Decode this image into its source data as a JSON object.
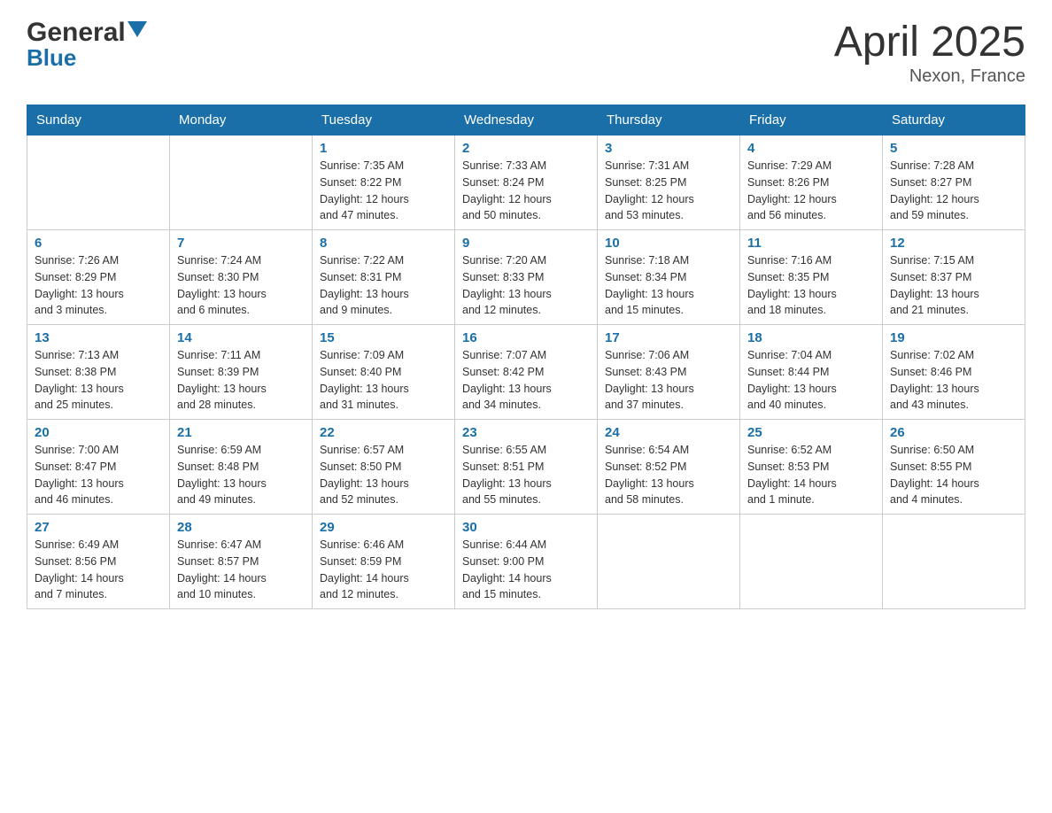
{
  "header": {
    "title": "April 2025",
    "subtitle": "Nexon, France",
    "logo_general": "General",
    "logo_blue": "Blue"
  },
  "calendar": {
    "days_of_week": [
      "Sunday",
      "Monday",
      "Tuesday",
      "Wednesday",
      "Thursday",
      "Friday",
      "Saturday"
    ],
    "weeks": [
      [
        {
          "day": "",
          "info": ""
        },
        {
          "day": "",
          "info": ""
        },
        {
          "day": "1",
          "info": "Sunrise: 7:35 AM\nSunset: 8:22 PM\nDaylight: 12 hours\nand 47 minutes."
        },
        {
          "day": "2",
          "info": "Sunrise: 7:33 AM\nSunset: 8:24 PM\nDaylight: 12 hours\nand 50 minutes."
        },
        {
          "day": "3",
          "info": "Sunrise: 7:31 AM\nSunset: 8:25 PM\nDaylight: 12 hours\nand 53 minutes."
        },
        {
          "day": "4",
          "info": "Sunrise: 7:29 AM\nSunset: 8:26 PM\nDaylight: 12 hours\nand 56 minutes."
        },
        {
          "day": "5",
          "info": "Sunrise: 7:28 AM\nSunset: 8:27 PM\nDaylight: 12 hours\nand 59 minutes."
        }
      ],
      [
        {
          "day": "6",
          "info": "Sunrise: 7:26 AM\nSunset: 8:29 PM\nDaylight: 13 hours\nand 3 minutes."
        },
        {
          "day": "7",
          "info": "Sunrise: 7:24 AM\nSunset: 8:30 PM\nDaylight: 13 hours\nand 6 minutes."
        },
        {
          "day": "8",
          "info": "Sunrise: 7:22 AM\nSunset: 8:31 PM\nDaylight: 13 hours\nand 9 minutes."
        },
        {
          "day": "9",
          "info": "Sunrise: 7:20 AM\nSunset: 8:33 PM\nDaylight: 13 hours\nand 12 minutes."
        },
        {
          "day": "10",
          "info": "Sunrise: 7:18 AM\nSunset: 8:34 PM\nDaylight: 13 hours\nand 15 minutes."
        },
        {
          "day": "11",
          "info": "Sunrise: 7:16 AM\nSunset: 8:35 PM\nDaylight: 13 hours\nand 18 minutes."
        },
        {
          "day": "12",
          "info": "Sunrise: 7:15 AM\nSunset: 8:37 PM\nDaylight: 13 hours\nand 21 minutes."
        }
      ],
      [
        {
          "day": "13",
          "info": "Sunrise: 7:13 AM\nSunset: 8:38 PM\nDaylight: 13 hours\nand 25 minutes."
        },
        {
          "day": "14",
          "info": "Sunrise: 7:11 AM\nSunset: 8:39 PM\nDaylight: 13 hours\nand 28 minutes."
        },
        {
          "day": "15",
          "info": "Sunrise: 7:09 AM\nSunset: 8:40 PM\nDaylight: 13 hours\nand 31 minutes."
        },
        {
          "day": "16",
          "info": "Sunrise: 7:07 AM\nSunset: 8:42 PM\nDaylight: 13 hours\nand 34 minutes."
        },
        {
          "day": "17",
          "info": "Sunrise: 7:06 AM\nSunset: 8:43 PM\nDaylight: 13 hours\nand 37 minutes."
        },
        {
          "day": "18",
          "info": "Sunrise: 7:04 AM\nSunset: 8:44 PM\nDaylight: 13 hours\nand 40 minutes."
        },
        {
          "day": "19",
          "info": "Sunrise: 7:02 AM\nSunset: 8:46 PM\nDaylight: 13 hours\nand 43 minutes."
        }
      ],
      [
        {
          "day": "20",
          "info": "Sunrise: 7:00 AM\nSunset: 8:47 PM\nDaylight: 13 hours\nand 46 minutes."
        },
        {
          "day": "21",
          "info": "Sunrise: 6:59 AM\nSunset: 8:48 PM\nDaylight: 13 hours\nand 49 minutes."
        },
        {
          "day": "22",
          "info": "Sunrise: 6:57 AM\nSunset: 8:50 PM\nDaylight: 13 hours\nand 52 minutes."
        },
        {
          "day": "23",
          "info": "Sunrise: 6:55 AM\nSunset: 8:51 PM\nDaylight: 13 hours\nand 55 minutes."
        },
        {
          "day": "24",
          "info": "Sunrise: 6:54 AM\nSunset: 8:52 PM\nDaylight: 13 hours\nand 58 minutes."
        },
        {
          "day": "25",
          "info": "Sunrise: 6:52 AM\nSunset: 8:53 PM\nDaylight: 14 hours\nand 1 minute."
        },
        {
          "day": "26",
          "info": "Sunrise: 6:50 AM\nSunset: 8:55 PM\nDaylight: 14 hours\nand 4 minutes."
        }
      ],
      [
        {
          "day": "27",
          "info": "Sunrise: 6:49 AM\nSunset: 8:56 PM\nDaylight: 14 hours\nand 7 minutes."
        },
        {
          "day": "28",
          "info": "Sunrise: 6:47 AM\nSunset: 8:57 PM\nDaylight: 14 hours\nand 10 minutes."
        },
        {
          "day": "29",
          "info": "Sunrise: 6:46 AM\nSunset: 8:59 PM\nDaylight: 14 hours\nand 12 minutes."
        },
        {
          "day": "30",
          "info": "Sunrise: 6:44 AM\nSunset: 9:00 PM\nDaylight: 14 hours\nand 15 minutes."
        },
        {
          "day": "",
          "info": ""
        },
        {
          "day": "",
          "info": ""
        },
        {
          "day": "",
          "info": ""
        }
      ]
    ]
  }
}
